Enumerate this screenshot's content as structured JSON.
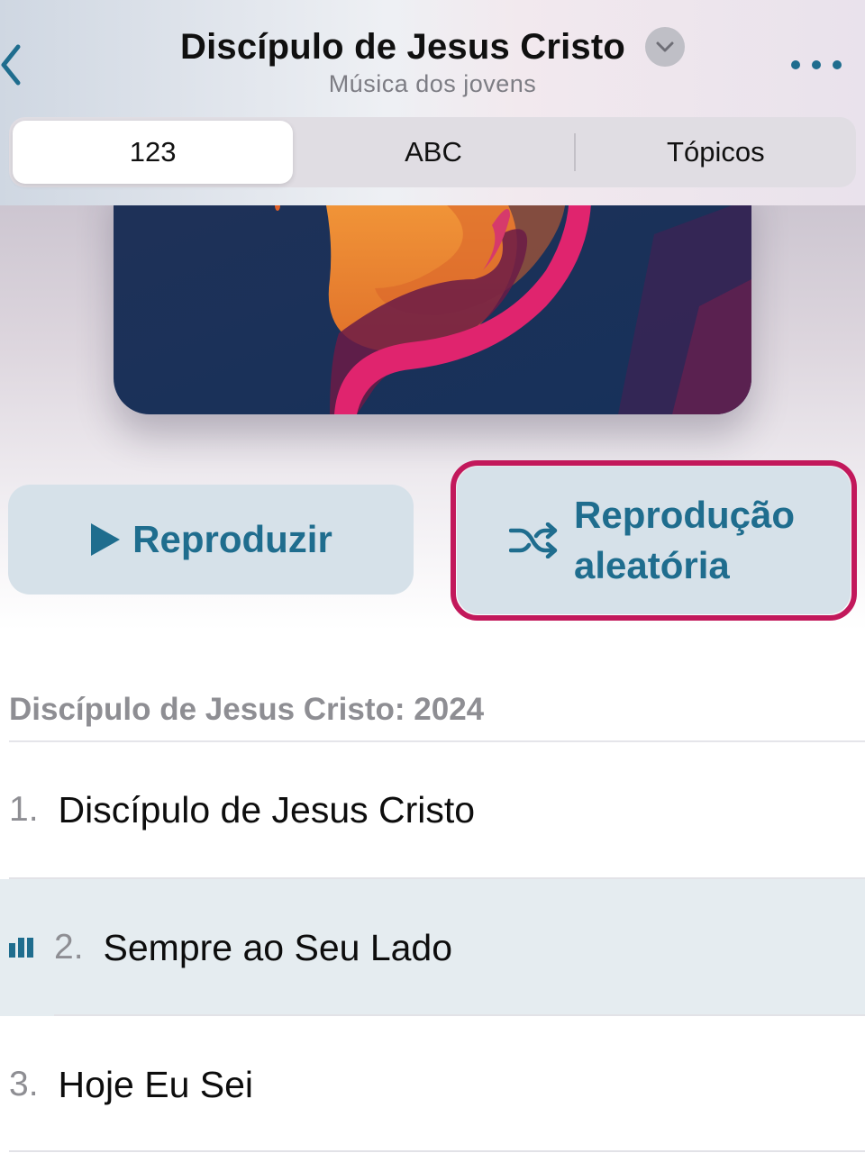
{
  "header": {
    "title": "Discípulo de Jesus Cristo",
    "subtitle": "Música dos jovens",
    "back_icon": "chevron-left-icon",
    "title_dropdown_icon": "chevron-down-icon",
    "more_icon": "ellipsis-icon"
  },
  "tabs": [
    {
      "label": "123",
      "selected": true
    },
    {
      "label": "ABC",
      "selected": false
    },
    {
      "label": "Tópicos",
      "selected": false
    }
  ],
  "actions": {
    "play_label": "Reproduzir",
    "play_icon": "play-icon",
    "shuffle_label_line1": "Reprodução",
    "shuffle_label_line2": "aleatória",
    "shuffle_icon": "shuffle-icon"
  },
  "section": {
    "title": "Discípulo de Jesus Cristo: 2024"
  },
  "tracks": [
    {
      "number": "1.",
      "title": "Discípulo de Jesus Cristo",
      "playing": false
    },
    {
      "number": "2.",
      "title": "Sempre ao Seu Lado",
      "playing": true
    },
    {
      "number": "3.",
      "title": "Hoje Eu Sei",
      "playing": false
    }
  ],
  "colors": {
    "accent": "#1f6d8e",
    "highlight_border": "#c2185b",
    "button_bg": "#d6e1e9",
    "playing_row_bg": "#e5ecf0"
  }
}
